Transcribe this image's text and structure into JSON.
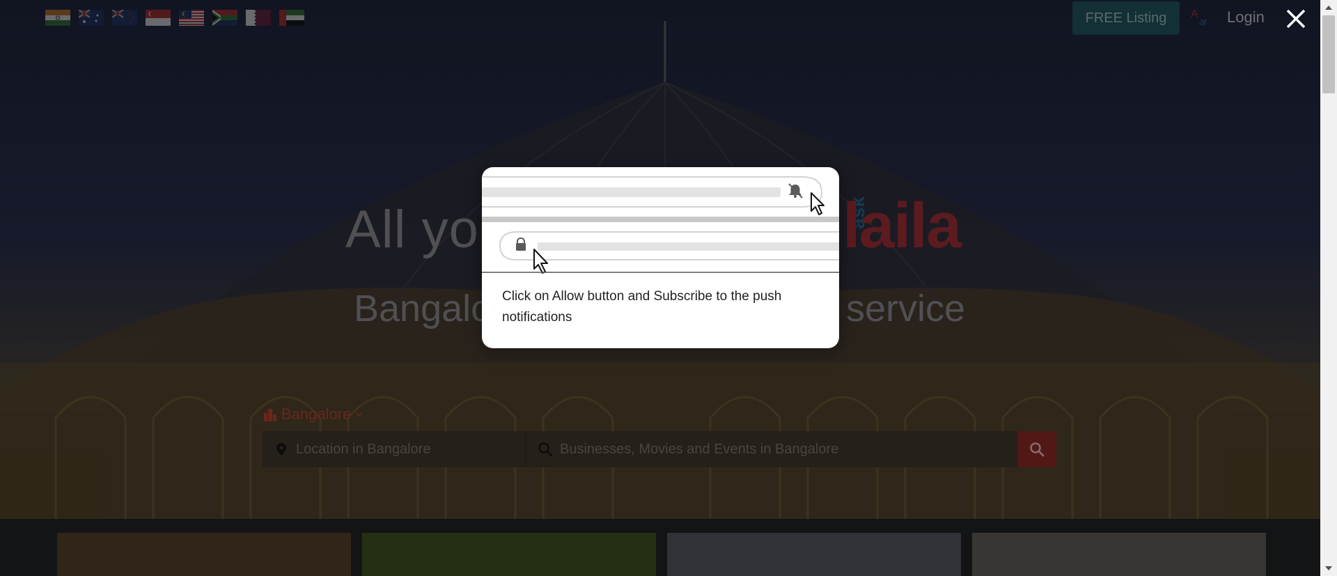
{
  "flags": [
    {
      "name": "india-flag-icon"
    },
    {
      "name": "australia-flag-icon"
    },
    {
      "name": "new-zealand-flag-icon"
    },
    {
      "name": "singapore-flag-icon"
    },
    {
      "name": "malaysia-flag-icon"
    },
    {
      "name": "south-africa-flag-icon"
    },
    {
      "name": "qatar-flag-icon"
    },
    {
      "name": "uae-flag-icon"
    }
  ],
  "header": {
    "free_listing_label": "FREE Listing",
    "login_label": "Login",
    "language_icon": "translate-icon",
    "close_icon": "close-icon"
  },
  "hero": {
    "headline": "All you",
    "subhead": "Bangalo",
    "subhead_right": "service",
    "logo_ask": "ask",
    "logo_text": "laila"
  },
  "search": {
    "city_label": "Bangalore",
    "location_placeholder": "Location in Bangalore",
    "query_placeholder": "Businesses, Movies and Events in Bangalore"
  },
  "modal": {
    "message": "Click on Allow button and Subscribe to the push notifications"
  },
  "colors": {
    "brand_red": "#c0392b",
    "brand_blue": "#2d7bb0",
    "free_listing_bg": "#1c4a52"
  }
}
